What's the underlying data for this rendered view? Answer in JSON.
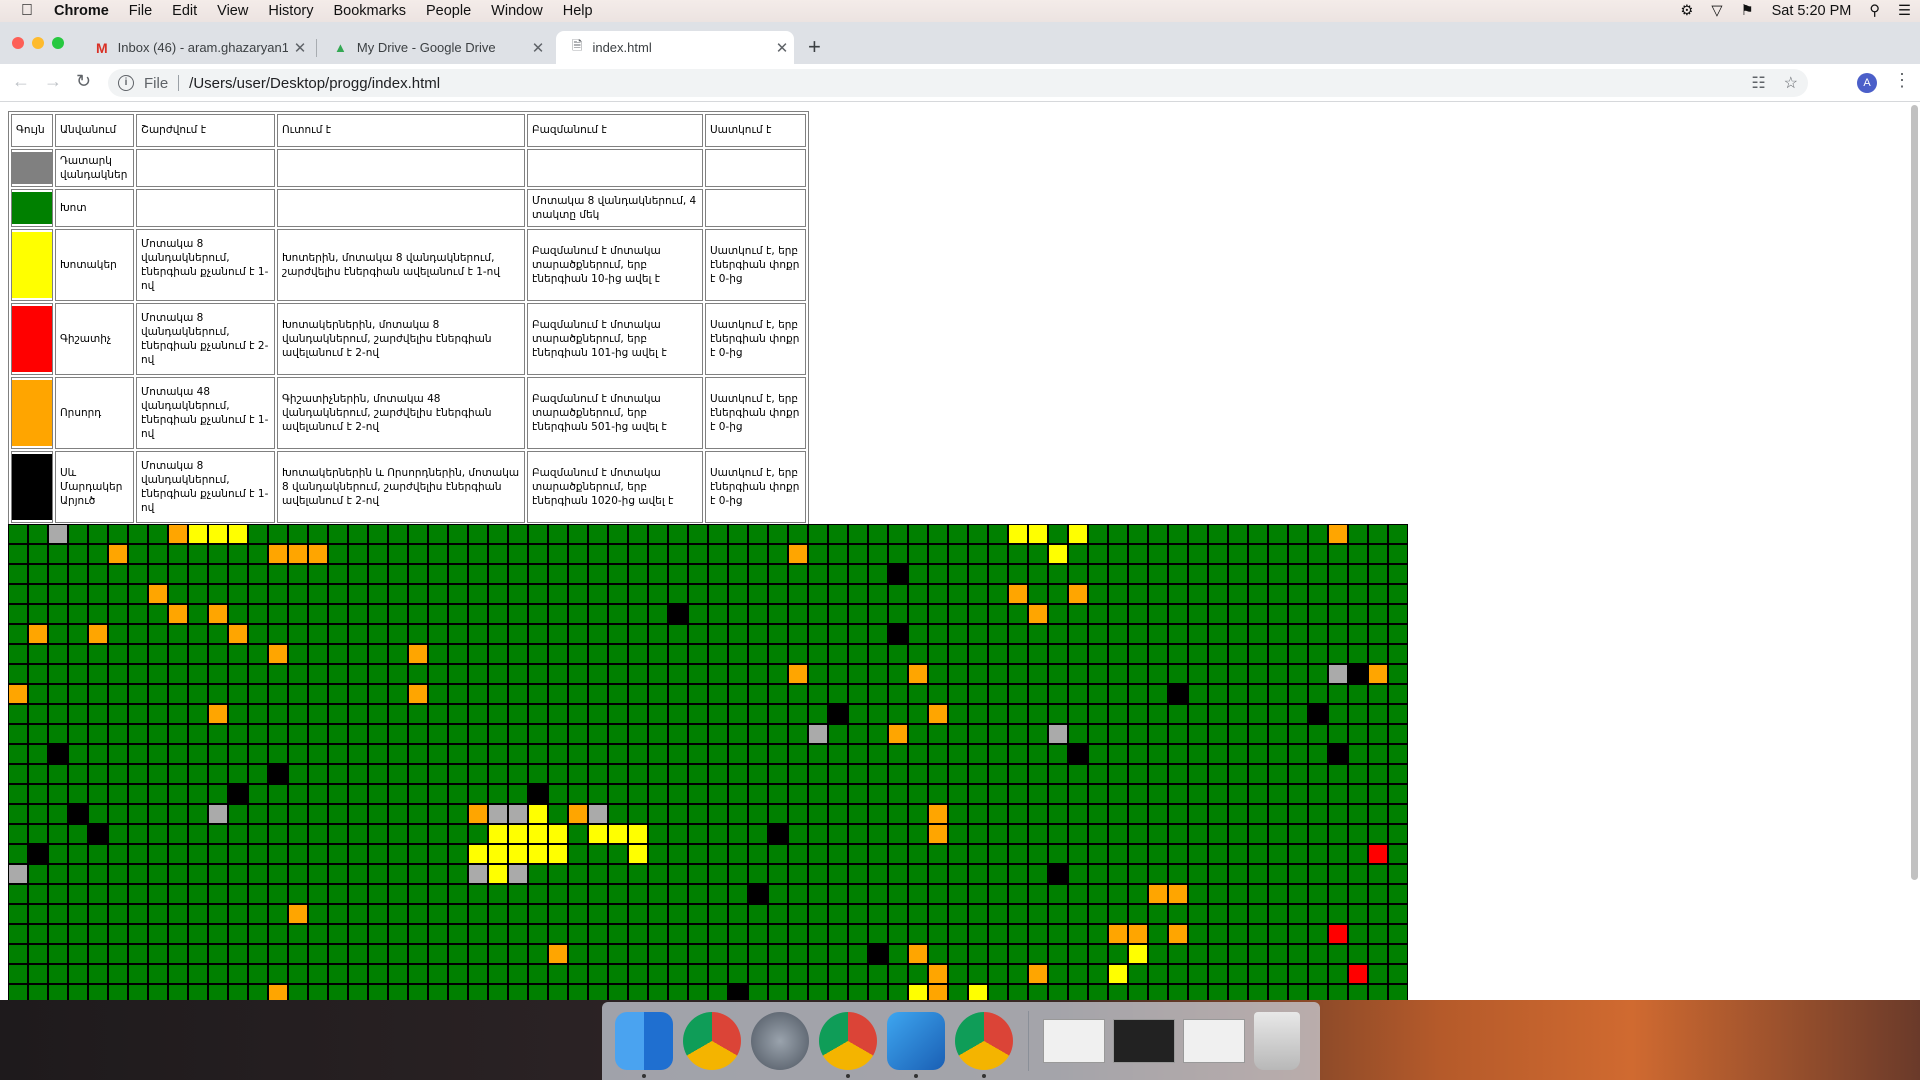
{
  "menubar": {
    "app": "Chrome",
    "items": [
      "File",
      "Edit",
      "View",
      "History",
      "Bookmarks",
      "People",
      "Window",
      "Help"
    ],
    "clock": "Sat 5:20 PM"
  },
  "tabs": [
    {
      "title": "Inbox (46) - aram.ghazaryan1..."
    },
    {
      "title": "My Drive - Google Drive"
    },
    {
      "title": "index.html"
    }
  ],
  "toolbar": {
    "scheme": "File",
    "url": "/Users/user/Desktop/progg/index.html",
    "avatar": "A"
  },
  "legend": {
    "headers": [
      "Գույն",
      "Անվանում",
      "Շարժվում է",
      "Ուտում է",
      "Բազմանում է",
      "Սատկում է"
    ],
    "rows": [
      {
        "color": "#808080",
        "name": "Դատարկ վանդակներ",
        "moves": "",
        "eats": "",
        "multiplies": "",
        "dies": ""
      },
      {
        "color": "#008000",
        "name": "Խոտ",
        "moves": "",
        "eats": "",
        "multiplies": "Մոտակա 8 վանդակներում, 4 տակտը մեկ",
        "dies": ""
      },
      {
        "color": "#ffff00",
        "name": "Խոտակեր",
        "moves": "Մոտակա 8 վանդակներում, էներգիան քչանում է 1-ով",
        "eats": "Խոտերին, մոտակա 8 վանդակներում, շարժվելիս էներգիան ավելանում է 1-ով",
        "multiplies": "Բազմանում է մոտակա տարածքներում, երբ էներգիան 10-ից ավել է",
        "dies": "Սատկում է, երբ էներգիան փոքր է 0-ից"
      },
      {
        "color": "#ff0000",
        "name": "Գիշատիչ",
        "moves": "Մոտակա 8 վանդակներում, էներգիան քչանում է 2-ով",
        "eats": "Խոտակերներին, մոտակա 8 վանդակներում, շարժվելիս էներգիան ավելանում է 2-ով",
        "multiplies": "Բազմանում է մոտակա տարածքներում, երբ էներգիան 101-ից ավել է",
        "dies": "Սատկում է, երբ էներգիան փոքր է 0-ից"
      },
      {
        "color": "#ffa500",
        "name": "Որսորդ",
        "moves": "Մոտակա 48 վանդակներում, էներգիան քչանում է 1-ով",
        "eats": "Գիշատիչներին, մոտակա 48 վանդակներում, շարժվելիս էներգիան ավելանում է 2-ով",
        "multiplies": "Բազմանում է մոտակա տարածքներում, երբ էներգիան 501-ից ավել է",
        "dies": "Սատկում է, երբ էներգիան փոքր է 0-ից"
      },
      {
        "color": "#000000",
        "name": "Սև Մարդակեր Արյուծ",
        "moves": "Մոտակա 8 վանդակներում, էներգիան քչանում է 1-ով",
        "eats": "Խոտակերներին և Որսորդներին, մոտակա 8 վանդակներում, շարժվելիս էներգիան ավելանում է 2-ով",
        "multiplies": "Բազմանում է մոտակա տարածքներում, երբ էներգիան 1020-ից ավել է",
        "dies": "Սատկում է, երբ էներգիան փոքր է 0-ից"
      }
    ]
  },
  "grid": {
    "cols": 70,
    "rows": 24,
    "colors": {
      "0": "#aaaaaa",
      "1": "#008000",
      "2": "#ffff00",
      "3": "#ff0000",
      "4": "#ffa500",
      "5": "#000000"
    },
    "cells": [
      [
        0,
        2,
        0
      ],
      [
        0,
        8,
        4
      ],
      [
        0,
        9,
        2
      ],
      [
        0,
        10,
        2
      ],
      [
        0,
        11,
        2
      ],
      [
        0,
        50,
        2
      ],
      [
        0,
        51,
        2
      ],
      [
        0,
        53,
        2
      ],
      [
        0,
        66,
        4
      ],
      [
        1,
        5,
        4
      ],
      [
        1,
        13,
        4
      ],
      [
        1,
        14,
        4
      ],
      [
        1,
        15,
        4
      ],
      [
        1,
        39,
        4
      ],
      [
        1,
        52,
        2
      ],
      [
        2,
        44,
        5
      ],
      [
        3,
        7,
        4
      ],
      [
        3,
        50,
        4
      ],
      [
        3,
        53,
        4
      ],
      [
        4,
        8,
        4
      ],
      [
        4,
        10,
        4
      ],
      [
        4,
        33,
        5
      ],
      [
        4,
        51,
        4
      ],
      [
        5,
        1,
        4
      ],
      [
        5,
        4,
        4
      ],
      [
        5,
        11,
        4
      ],
      [
        5,
        44,
        5
      ],
      [
        6,
        13,
        4
      ],
      [
        6,
        20,
        4
      ],
      [
        7,
        39,
        4
      ],
      [
        7,
        45,
        4
      ],
      [
        7,
        66,
        0
      ],
      [
        7,
        67,
        5
      ],
      [
        7,
        68,
        4
      ],
      [
        8,
        0,
        4
      ],
      [
        8,
        20,
        4
      ],
      [
        8,
        58,
        5
      ],
      [
        9,
        10,
        4
      ],
      [
        9,
        41,
        5
      ],
      [
        9,
        46,
        4
      ],
      [
        9,
        65,
        5
      ],
      [
        10,
        40,
        0
      ],
      [
        10,
        44,
        4
      ],
      [
        10,
        52,
        0
      ],
      [
        11,
        2,
        5
      ],
      [
        11,
        53,
        5
      ],
      [
        11,
        66,
        5
      ],
      [
        12,
        13,
        5
      ],
      [
        13,
        11,
        5
      ],
      [
        13,
        26,
        5
      ],
      [
        14,
        3,
        5
      ],
      [
        14,
        10,
        0
      ],
      [
        14,
        23,
        4
      ],
      [
        14,
        24,
        0
      ],
      [
        14,
        25,
        0
      ],
      [
        14,
        26,
        2
      ],
      [
        14,
        28,
        4
      ],
      [
        14,
        29,
        0
      ],
      [
        14,
        46,
        4
      ],
      [
        15,
        4,
        5
      ],
      [
        15,
        24,
        2
      ],
      [
        15,
        25,
        2
      ],
      [
        15,
        26,
        2
      ],
      [
        15,
        27,
        2
      ],
      [
        15,
        29,
        2
      ],
      [
        15,
        30,
        2
      ],
      [
        15,
        31,
        2
      ],
      [
        15,
        38,
        5
      ],
      [
        15,
        46,
        4
      ],
      [
        16,
        1,
        5
      ],
      [
        16,
        23,
        2
      ],
      [
        16,
        24,
        2
      ],
      [
        16,
        25,
        2
      ],
      [
        16,
        26,
        2
      ],
      [
        16,
        27,
        2
      ],
      [
        16,
        31,
        2
      ],
      [
        16,
        68,
        3
      ],
      [
        17,
        0,
        0
      ],
      [
        17,
        23,
        0
      ],
      [
        17,
        24,
        2
      ],
      [
        17,
        25,
        0
      ],
      [
        17,
        52,
        5
      ],
      [
        18,
        37,
        5
      ],
      [
        18,
        57,
        4
      ],
      [
        18,
        58,
        4
      ],
      [
        19,
        14,
        4
      ],
      [
        20,
        55,
        4
      ],
      [
        20,
        56,
        4
      ],
      [
        20,
        58,
        4
      ],
      [
        20,
        66,
        3
      ],
      [
        21,
        27,
        4
      ],
      [
        21,
        43,
        5
      ],
      [
        21,
        45,
        4
      ],
      [
        21,
        56,
        2
      ],
      [
        22,
        46,
        4
      ],
      [
        22,
        51,
        4
      ],
      [
        22,
        55,
        2
      ],
      [
        22,
        67,
        3
      ],
      [
        23,
        13,
        4
      ],
      [
        23,
        36,
        5
      ],
      [
        23,
        45,
        2
      ],
      [
        23,
        46,
        4
      ],
      [
        23,
        48,
        2
      ]
    ]
  },
  "dock": {
    "items": [
      "finder-icon",
      "chrome-icon",
      "launchpad-icon",
      "chrome-icon",
      "vscode-icon",
      "chrome-icon"
    ]
  }
}
